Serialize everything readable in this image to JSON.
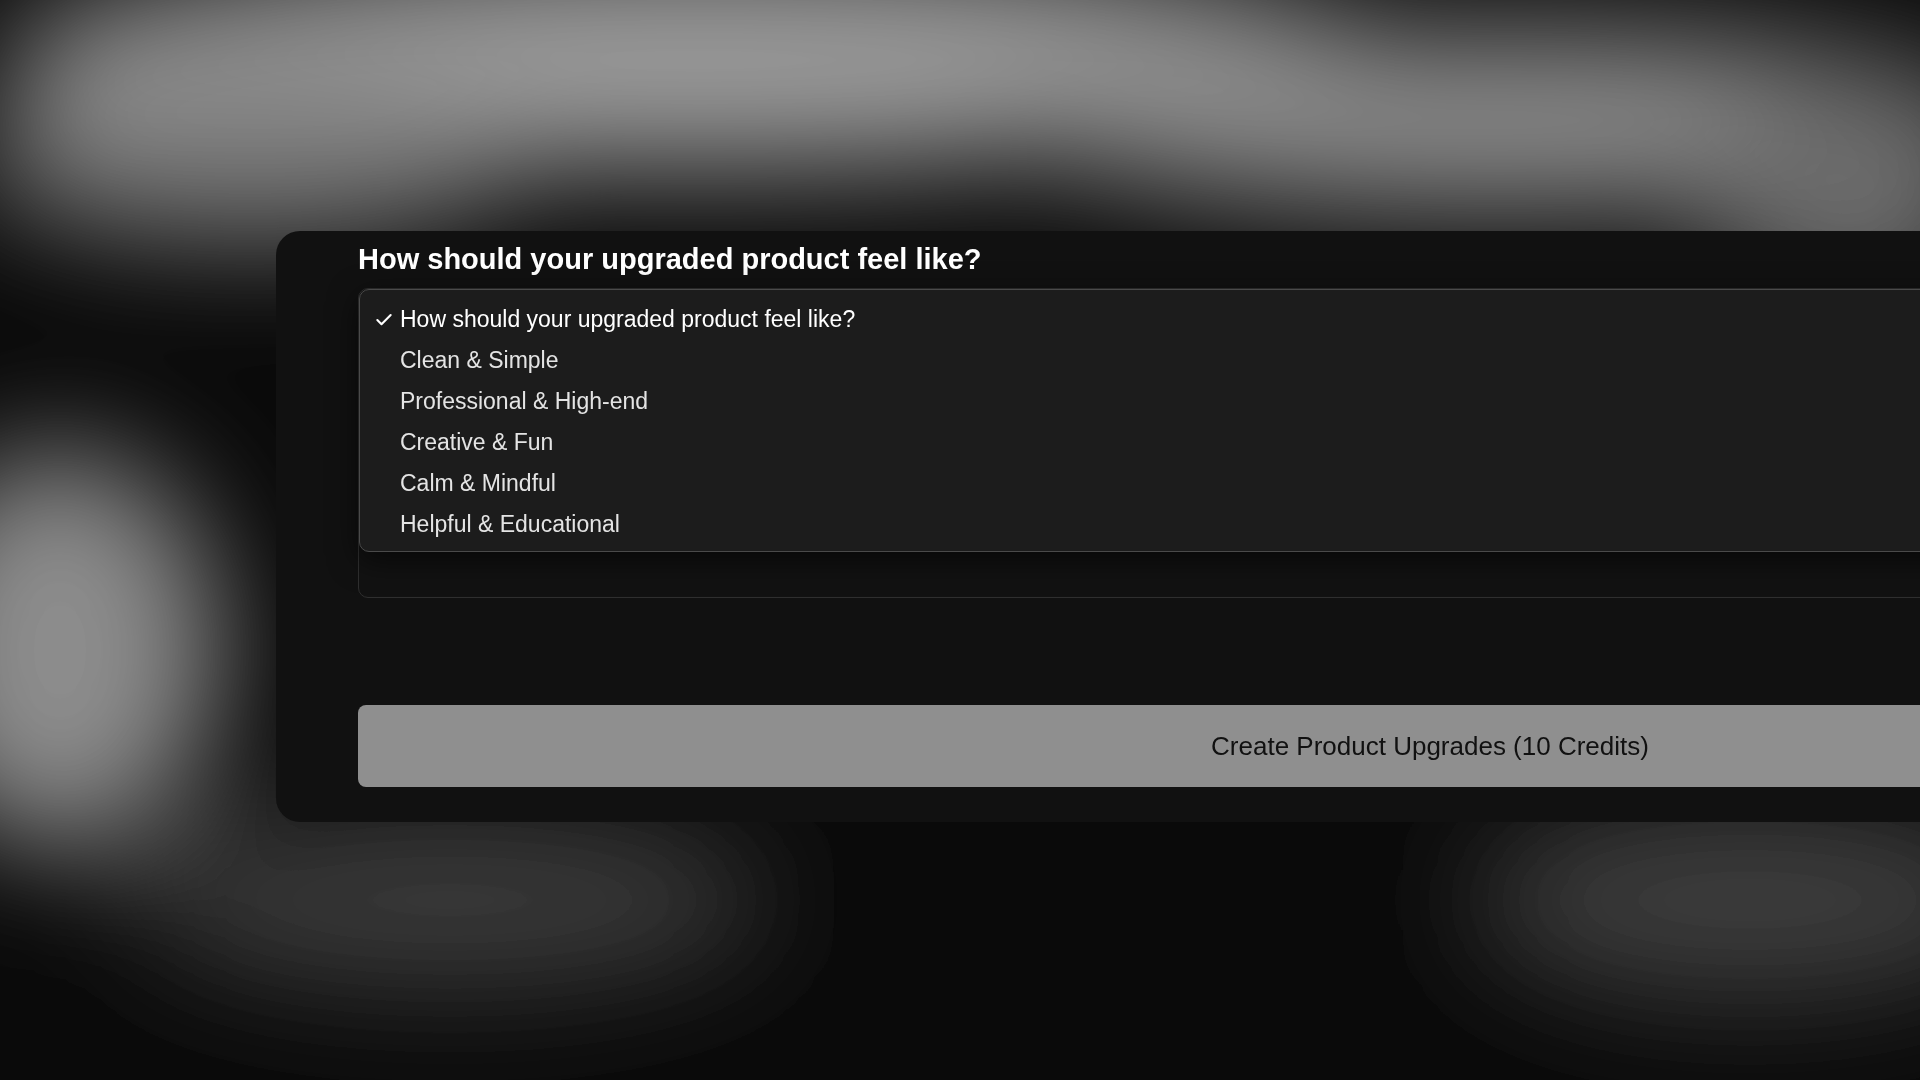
{
  "question": {
    "title": "How should your upgraded product feel like?"
  },
  "dropdown": {
    "options": [
      {
        "label": "How should your upgraded product feel like?",
        "selected": true
      },
      {
        "label": "Clean & Simple",
        "selected": false
      },
      {
        "label": "Professional & High-end",
        "selected": false
      },
      {
        "label": "Creative & Fun",
        "selected": false
      },
      {
        "label": "Calm & Mindful",
        "selected": false
      },
      {
        "label": "Helpful & Educational",
        "selected": false
      }
    ]
  },
  "button": {
    "label": "Create Product Upgrades (10 Credits)"
  }
}
